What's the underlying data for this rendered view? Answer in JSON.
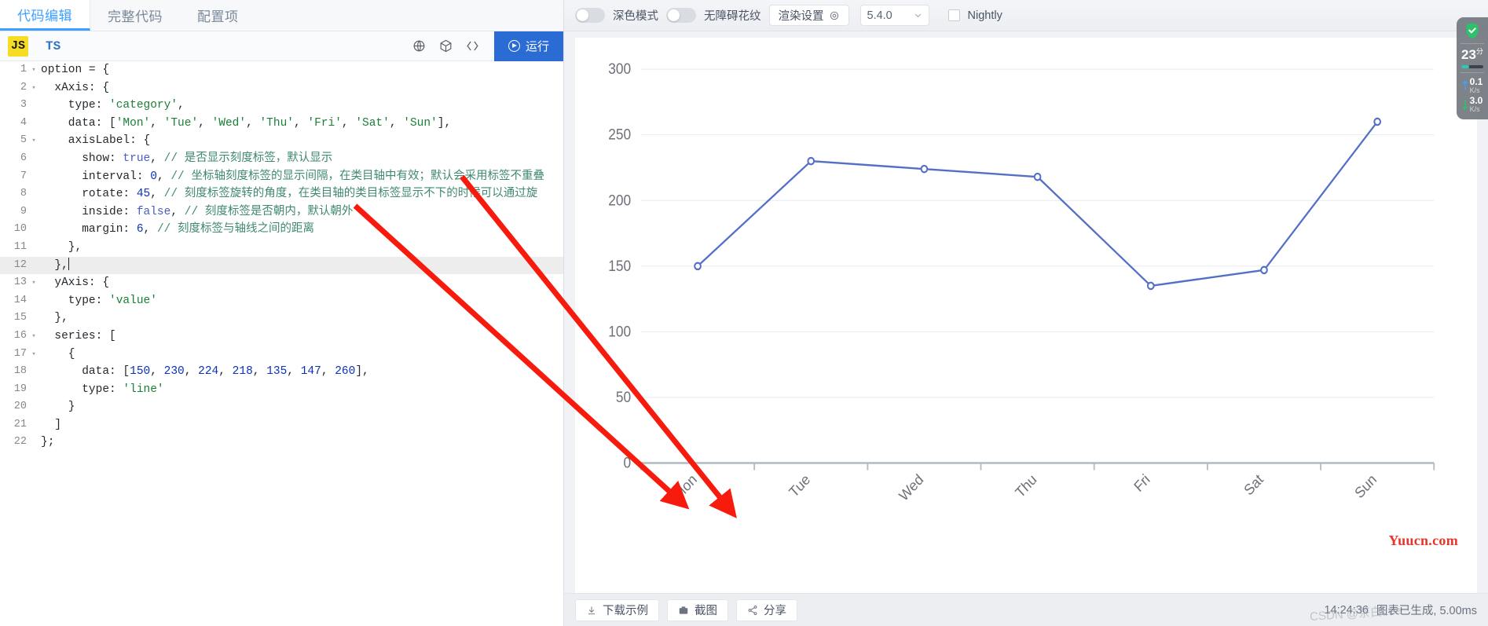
{
  "editor": {
    "tabs": [
      {
        "label": "代码编辑",
        "active": true
      },
      {
        "label": "完整代码",
        "active": false
      },
      {
        "label": "配置项",
        "active": false
      }
    ],
    "lang_js": "JS",
    "lang_ts": "TS",
    "icons": [
      "sphere-icon",
      "cube-icon",
      "code-brackets-icon"
    ],
    "run_label": "运行",
    "code_lines": [
      {
        "n": "1",
        "fold": "▾",
        "tokens": [
          [
            "plain",
            "option = {"
          ]
        ]
      },
      {
        "n": "2",
        "fold": "▾",
        "tokens": [
          [
            "plain",
            "  xAxis: {"
          ]
        ]
      },
      {
        "n": "3",
        "fold": "",
        "tokens": [
          [
            "plain",
            "    type: "
          ],
          [
            "str",
            "'category'"
          ],
          [
            "plain",
            ","
          ]
        ]
      },
      {
        "n": "4",
        "fold": "",
        "tokens": [
          [
            "plain",
            "    data: ["
          ],
          [
            "str",
            "'Mon'"
          ],
          [
            "plain",
            ", "
          ],
          [
            "str",
            "'Tue'"
          ],
          [
            "plain",
            ", "
          ],
          [
            "str",
            "'Wed'"
          ],
          [
            "plain",
            ", "
          ],
          [
            "str",
            "'Thu'"
          ],
          [
            "plain",
            ", "
          ],
          [
            "str",
            "'Fri'"
          ],
          [
            "plain",
            ", "
          ],
          [
            "str",
            "'Sat'"
          ],
          [
            "plain",
            ", "
          ],
          [
            "str",
            "'Sun'"
          ],
          [
            "plain",
            "],"
          ]
        ]
      },
      {
        "n": "5",
        "fold": "▾",
        "tokens": [
          [
            "plain",
            "    axisLabel: {"
          ]
        ]
      },
      {
        "n": "6",
        "fold": "",
        "tokens": [
          [
            "plain",
            "      show: "
          ],
          [
            "kw",
            "true"
          ],
          [
            "plain",
            ", "
          ],
          [
            "com",
            "// 是否显示刻度标签，默认显示"
          ]
        ]
      },
      {
        "n": "7",
        "fold": "",
        "tokens": [
          [
            "plain",
            "      interval: "
          ],
          [
            "num",
            "0"
          ],
          [
            "plain",
            ", "
          ],
          [
            "com",
            "// 坐标轴刻度标签的显示间隔，在类目轴中有效；默认会采用标签不重叠"
          ]
        ]
      },
      {
        "n": "8",
        "fold": "",
        "tokens": [
          [
            "plain",
            "      rotate: "
          ],
          [
            "num",
            "45"
          ],
          [
            "plain",
            ", "
          ],
          [
            "com",
            "// 刻度标签旋转的角度，在类目轴的类目标签显示不下的时候可以通过旋"
          ]
        ]
      },
      {
        "n": "9",
        "fold": "",
        "tokens": [
          [
            "plain",
            "      inside: "
          ],
          [
            "kw",
            "false"
          ],
          [
            "plain",
            ", "
          ],
          [
            "com",
            "// 刻度标签是否朝内，默认朝外"
          ]
        ]
      },
      {
        "n": "10",
        "fold": "",
        "tokens": [
          [
            "plain",
            "      margin: "
          ],
          [
            "num",
            "6"
          ],
          [
            "plain",
            ", "
          ],
          [
            "com",
            "// 刻度标签与轴线之间的距离"
          ]
        ]
      },
      {
        "n": "11",
        "fold": "",
        "tokens": [
          [
            "plain",
            "    },"
          ]
        ]
      },
      {
        "n": "12",
        "fold": "",
        "tokens": [
          [
            "plain",
            "  },"
          ]
        ],
        "highlight": true,
        "caret": true
      },
      {
        "n": "13",
        "fold": "▾",
        "tokens": [
          [
            "plain",
            "  yAxis: {"
          ]
        ]
      },
      {
        "n": "14",
        "fold": "",
        "tokens": [
          [
            "plain",
            "    type: "
          ],
          [
            "str",
            "'value'"
          ]
        ]
      },
      {
        "n": "15",
        "fold": "",
        "tokens": [
          [
            "plain",
            "  },"
          ]
        ]
      },
      {
        "n": "16",
        "fold": "▾",
        "tokens": [
          [
            "plain",
            "  series: ["
          ]
        ]
      },
      {
        "n": "17",
        "fold": "▾",
        "tokens": [
          [
            "plain",
            "    {"
          ]
        ]
      },
      {
        "n": "18",
        "fold": "",
        "tokens": [
          [
            "plain",
            "      data: ["
          ],
          [
            "num",
            "150"
          ],
          [
            "plain",
            ", "
          ],
          [
            "num",
            "230"
          ],
          [
            "plain",
            ", "
          ],
          [
            "num",
            "224"
          ],
          [
            "plain",
            ", "
          ],
          [
            "num",
            "218"
          ],
          [
            "plain",
            ", "
          ],
          [
            "num",
            "135"
          ],
          [
            "plain",
            ", "
          ],
          [
            "num",
            "147"
          ],
          [
            "plain",
            ", "
          ],
          [
            "num",
            "260"
          ],
          [
            "plain",
            "],"
          ]
        ]
      },
      {
        "n": "19",
        "fold": "",
        "tokens": [
          [
            "plain",
            "      type: "
          ],
          [
            "str",
            "'line'"
          ]
        ]
      },
      {
        "n": "20",
        "fold": "",
        "tokens": [
          [
            "plain",
            "    }"
          ]
        ]
      },
      {
        "n": "21",
        "fold": "",
        "tokens": [
          [
            "plain",
            "  ]"
          ]
        ]
      },
      {
        "n": "22",
        "fold": "",
        "tokens": [
          [
            "plain",
            "};"
          ]
        ]
      }
    ]
  },
  "toolbar": {
    "dark_mode_label": "深色模式",
    "dark_mode_on": false,
    "accessibility_label": "无障碍花纹",
    "accessibility_on": false,
    "render_settings_label": "渲染设置",
    "version": "5.4.0",
    "nightly_label": "Nightly",
    "nightly_checked": false
  },
  "bottom": {
    "download_label": "下载示例",
    "screenshot_label": "截图",
    "share_label": "分享",
    "time": "14:24:36",
    "status": "图表已生成, 5.00ms"
  },
  "watermark": {
    "main": "Yuucn.com",
    "secondary": "CSDN @茶白Lee"
  },
  "widget": {
    "score": "23",
    "score_unit": "分",
    "up_value": "0.1",
    "up_unit": "K/s",
    "down_value": "3.0",
    "down_unit": "K/s"
  },
  "chart_data": {
    "type": "line",
    "title": "",
    "xlabel": "",
    "ylabel": "",
    "categories": [
      "Mon",
      "Tue",
      "Wed",
      "Thu",
      "Fri",
      "Sat",
      "Sun"
    ],
    "values": [
      150,
      230,
      224,
      218,
      135,
      147,
      260
    ],
    "yticks": [
      0,
      50,
      100,
      150,
      200,
      250,
      300
    ],
    "ylim": [
      0,
      300
    ],
    "grid": true,
    "legend": false,
    "series_color": "#5470c6",
    "axis_label_rotate": 45,
    "series": [
      {
        "name": "",
        "values": [
          150,
          230,
          224,
          218,
          135,
          147,
          260
        ]
      }
    ]
  }
}
